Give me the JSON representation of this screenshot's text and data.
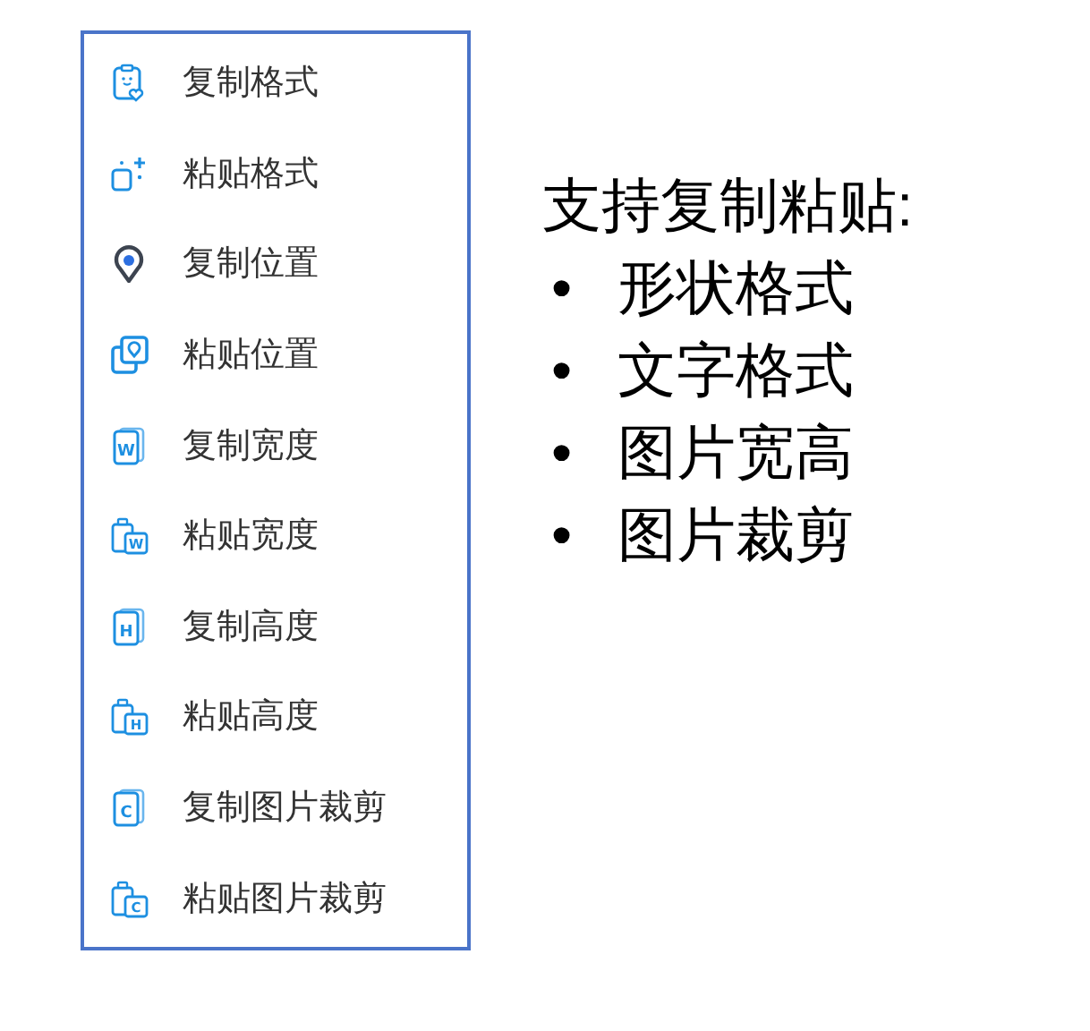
{
  "menu": {
    "items": [
      {
        "kind": "face-clipboard",
        "label": "复制格式"
      },
      {
        "kind": "sparkle-square",
        "label": "粘贴格式"
      },
      {
        "kind": "pin",
        "label": "复制位置"
      },
      {
        "kind": "paste-pin",
        "label": "粘贴位置"
      },
      {
        "kind": "copy-letter",
        "letter": "W",
        "label": "复制宽度"
      },
      {
        "kind": "paste-letter",
        "letter": "W",
        "label": "粘贴宽度"
      },
      {
        "kind": "copy-letter",
        "letter": "H",
        "label": "复制高度"
      },
      {
        "kind": "paste-letter",
        "letter": "H",
        "label": "粘贴高度"
      },
      {
        "kind": "copy-letter",
        "letter": "C",
        "label": "复制图片裁剪"
      },
      {
        "kind": "paste-letter",
        "letter": "C",
        "label": "粘贴图片裁剪"
      }
    ]
  },
  "note": {
    "heading": "支持复制粘贴:",
    "items": [
      {
        "bullet": "•",
        "text": "形状格式"
      },
      {
        "bullet": "•",
        "text": "文字格式"
      },
      {
        "bullet": "•",
        "text": "图片宽高"
      },
      {
        "bullet": "•",
        "text": "图片裁剪"
      }
    ]
  }
}
